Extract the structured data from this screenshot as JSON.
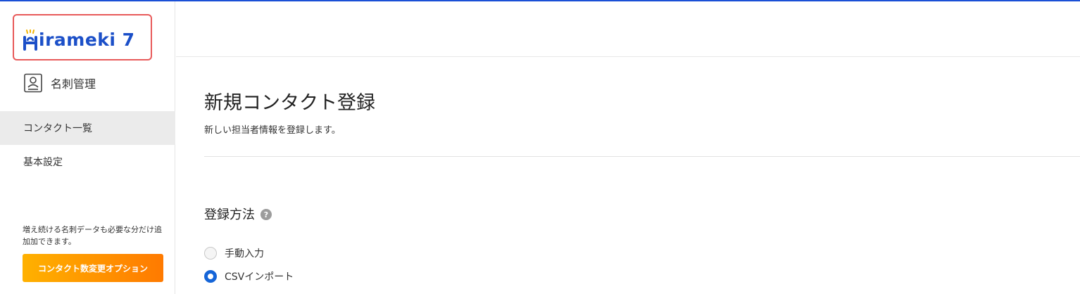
{
  "app": {
    "logo_text": "irameki 7",
    "brand_label": "名刺管理",
    "accent_color": "#1b4fc8"
  },
  "sidebar": {
    "items": [
      {
        "label": "コンタクト一覧",
        "active": true
      },
      {
        "label": "基本設定",
        "active": false
      }
    ],
    "promo_text": "増え続ける名刺データも必要な分だけ追加加できます。",
    "promo_button_label": "コンタクト数変更オプション"
  },
  "main": {
    "title": "新規コンタクト登録",
    "subtitle": "新しい担当者情報を登録します。",
    "section_title": "登録方法",
    "help_icon_glyph": "?",
    "options": [
      {
        "label": "手動入力",
        "selected": false
      },
      {
        "label": "CSVインポート",
        "selected": true
      }
    ]
  }
}
